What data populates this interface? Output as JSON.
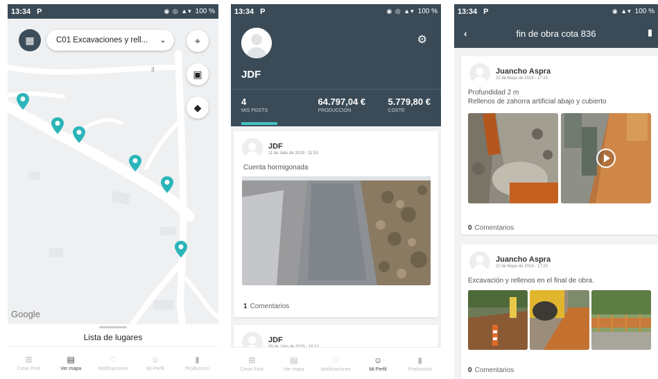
{
  "status": {
    "time": "13:34",
    "app_badge": "P",
    "battery": "100 %"
  },
  "map_screen": {
    "project_select": "C01 Excavaciones y rell...",
    "google_label": "Google",
    "places_title": "Lista de lugares"
  },
  "nav": {
    "items": [
      {
        "label": "Crear Post",
        "icon": "plus-square-icon"
      },
      {
        "label": "Ver mapa",
        "icon": "map-icon"
      },
      {
        "label": "Notificaciones",
        "icon": "bell-icon"
      },
      {
        "label": "Mi Perfil",
        "icon": "user-icon"
      },
      {
        "label": "Producción",
        "icon": "document-icon"
      }
    ]
  },
  "profile": {
    "name": "JDF",
    "stats": [
      {
        "value": "4",
        "caption": "MIS POSTS"
      },
      {
        "value": "64.797,04 €",
        "caption": "PRODUCCIÓN"
      },
      {
        "value": "5.779,80 €",
        "caption": "COSTE"
      }
    ],
    "posts": [
      {
        "author": "JDF",
        "date": "11 de Julio de 2019 - 11:53",
        "text": "Cuenta hormigonada",
        "comments_count": "1",
        "comments_label": "Comentarios"
      },
      {
        "author": "JDF",
        "date": "08 de Julio de 2019 - 18:13"
      }
    ]
  },
  "thread": {
    "title": "fin de obra cota 836",
    "posts": [
      {
        "author": "Juancho Aspra",
        "date": "22 de Mayo de 2019 - 17:23",
        "text": "Profundidad 2 m\nRellenos de zahorra artificial abajo y cubierto",
        "comments_count": "0",
        "comments_label": "Comentarios"
      },
      {
        "author": "Juancho Aspra",
        "date": "22 de Mayo de 2019 - 17:22",
        "text": "Excavación y rellenos en el final de obra.",
        "comments_count": "0",
        "comments_label": "Comentarios"
      }
    ]
  },
  "colors": {
    "header": "#3a4b57",
    "accent": "#43c3c4"
  }
}
